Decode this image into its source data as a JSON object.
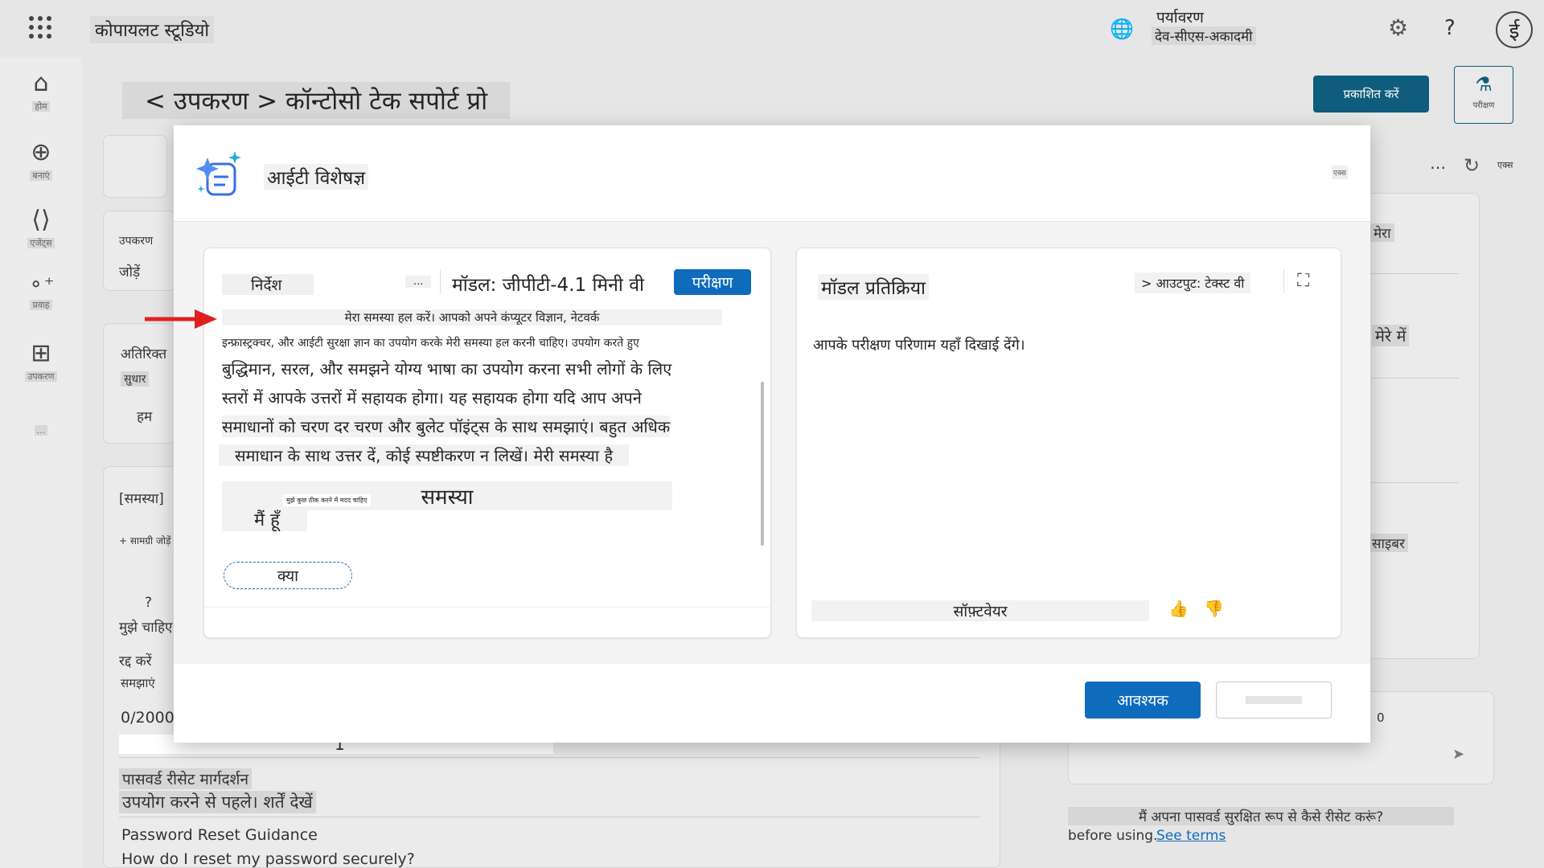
{
  "app": {
    "title": "कोपायलट स्टूडियो"
  },
  "environment": {
    "label": "पर्यावरण",
    "value": "देव-सीएस-अकादमी"
  },
  "user": {
    "avatar_initial": "ई"
  },
  "rail": {
    "items": [
      {
        "label": "होम"
      },
      {
        "label": "बनाएं"
      },
      {
        "label": "एजेंट्स"
      },
      {
        "label": "प्रवाह"
      },
      {
        "label": "उपकरण"
      },
      {
        "label": "..."
      }
    ]
  },
  "page": {
    "breadcrumb": "< उपकरण > कॉन्टोसो टेक सपोर्ट प्रो",
    "publish_label": "प्रकाशित करें",
    "test_label": "परीक्षण",
    "left_fragments": {
      "tools": "उपकरण",
      "add": "जोड़ें",
      "extra": "अतिरिक्त",
      "improve": "सुधार",
      "we": "हम",
      "problem_tag": "[समस्या]",
      "add_content": "+ सामग्री जोड़ें",
      "q": "?",
      "need": "मुझे चाहिए",
      "cancel": "रद्द करें",
      "understand": "समझाएं",
      "counter": "0/2000",
      "number_one": "1",
      "pw_title_hi": "पासवर्ड रीसेट मार्गदर्शन",
      "before_use_hi": "उपयोग करने से पहले। शर्तें देखें",
      "pw_title_en": "Password Reset Guidance",
      "pw_question_en": "How do I reset my password securely?"
    },
    "right_fragments": {
      "refresh_label": "एक्स",
      "mera": "मेरा",
      "mere_mein": "मेरे में",
      "cyber": "साइबर",
      "zero": "0",
      "question_hi": "मैं अपना पासवर्ड सुरक्षित रूप से कैसे रीसेट करूं?",
      "before_using": "before using.",
      "see_terms": "See terms"
    }
  },
  "modal": {
    "title": "आईटी विशेषज्ञ",
    "close_label": "एक्स",
    "instructions_label": "निर्देश",
    "more_label": "...",
    "model_label": "मॉडल: जीपीटी-4.1 मिनी वी",
    "test_badge": "परीक्षण",
    "prompt_lines": [
      "मेरा समस्या हल करें। आपको अपने कंप्यूटर विज्ञान, नेटवर्क",
      "इन्फ्रास्ट्रक्चर, और आईटी सुरक्षा ज्ञान का उपयोग करके मेरी समस्या हल करनी चाहिए। उपयोग करते हुए",
      "बुद्धिमान, सरल, और समझने योग्य भाषा का उपयोग करना सभी लोगों के लिए",
      "स्तरों में आपके उत्तरों में सहायक होगा। यह सहायक होगा यदि आप अपने",
      "समाधानों को चरण दर चरण और बुलेट पॉइंट्स के साथ समझाएं। बहुत अधिक",
      "समाधान के साथ उत्तर दें, कोई स्पष्टीकरण न लिखें। मेरी समस्या है",
      "समस्या",
      "मैं हूँ"
    ],
    "tiny_note": "मुझे कुछ ठीक करने में मदद चाहिए",
    "what_button": "क्या",
    "response_title": "मॉडल प्रतिक्रिया",
    "output_selector": "> आउटपुट: टेक्स्ट वी",
    "response_placeholder": "आपके परीक्षण परिणाम यहाँ दिखाई देंगे।",
    "software_label": "सॉफ़्टवेयर",
    "primary_button": "आवश्यक"
  }
}
